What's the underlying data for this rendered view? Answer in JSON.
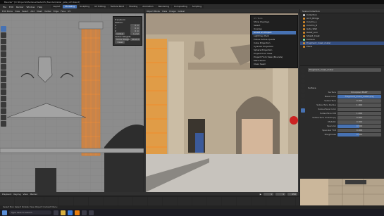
{
  "app": {
    "title": "Blender* [D:\\Projects\\Medieval\\Gate\\05_Blender\\zadar_gate_v03.blend]"
  },
  "menubar": {
    "items": [
      "File",
      "Edit",
      "Render",
      "Window",
      "Help"
    ],
    "workspaces": [
      "Layout",
      "Modeling",
      "Sculpting",
      "UV Editing",
      "Texture Paint",
      "Shading",
      "Animation",
      "Rendering",
      "Compositing",
      "Scripting"
    ],
    "active_workspace": "Modeling"
  },
  "left_viewport": {
    "header": [
      "Edit Mode",
      "View",
      "Select",
      "Add",
      "Mesh",
      "Vertex",
      "Edge",
      "Face",
      "UV"
    ],
    "npanel": {
      "title": "Transform",
      "rows": [
        {
          "label": "Median:",
          "value": ""
        },
        {
          "label": "X",
          "value": "0 m"
        },
        {
          "label": "Y",
          "value": "0 m"
        },
        {
          "label": "Z",
          "value": "0 m"
        },
        {
          "label": "Global",
          "value": "Local"
        },
        {
          "label": "Vertex Weights",
          "value": ""
        },
        {
          "label": "Show Weight",
          "value": "Stretch"
        },
        {
          "label": "Clean",
          "value": ""
        }
      ]
    }
  },
  "right_viewport": {
    "header": [
      "Object Mode",
      "View",
      "Image",
      "Global"
    ],
    "ctx_menu": {
      "title": "UV Tools",
      "items": [
        "Show Overlays",
        "Select",
        "Unwrap",
        "Smart UV Project",
        "Lightmap Pack",
        "Follow Active Quads",
        "Cube Projection",
        "Cylinder Projection",
        "Sphere Projection",
        "Project from View",
        "Project From View (Bounds)",
        "Mark Seam",
        "Clear Seam"
      ],
      "highlighted": 3
    }
  },
  "outliner": {
    "header": "Scene Collection",
    "items": [
      {
        "name": "Collection",
        "selected": false
      },
      {
        "name": "Arch_Bridge",
        "selected": false
      },
      {
        "name": "Column_L",
        "selected": false
      },
      {
        "name": "Column_R",
        "selected": false
      },
      {
        "name": "Gate_Wall",
        "selected": false
      },
      {
        "name": "Relief_Lion",
        "selected": false
      },
      {
        "name": "Shield_Crest",
        "selected": false
      },
      {
        "name": "Camera",
        "selected": false
      },
      {
        "name": "Fragment_mask_meter",
        "selected": true
      },
      {
        "name": "Plane",
        "selected": false
      }
    ]
  },
  "properties": {
    "object_name": "Fragment_mask_meter",
    "section": "Surface",
    "surface": "Principled BSDF",
    "rows": [
      {
        "label": "Base Color",
        "value": "Fragment_mask_meter.png",
        "style": "blue"
      },
      {
        "label": "Subsurface",
        "value": "0.000",
        "style": "normal"
      },
      {
        "label": "Subsurface Radius",
        "value": "1.000",
        "style": "normal"
      },
      {
        "label": "Subsurface Color",
        "value": "",
        "style": "normal"
      },
      {
        "label": "Subsurface IOR",
        "value": "1.400",
        "style": "normal"
      },
      {
        "label": "Subsurface Anisotropy",
        "value": "0.000",
        "style": "normal"
      },
      {
        "label": "Metallic",
        "value": "0.000",
        "style": "normal"
      },
      {
        "label": "Specular",
        "value": "0.500",
        "style": "bar",
        "fraction": 0.5
      },
      {
        "label": "Specular Tint",
        "value": "0.000",
        "style": "normal"
      },
      {
        "label": "Roughness",
        "value": "0.500",
        "style": "bar",
        "fraction": 0.5
      }
    ]
  },
  "timeline": {
    "header": [
      "Playback",
      "Keying",
      "View",
      "Marker"
    ],
    "frame": "1",
    "start": "1",
    "end": "250"
  },
  "statusbar": {
    "text": "Select    Box Select    Rotate View    Object Context Menu"
  },
  "taskbar": {
    "search_placeholder": "Type here to search"
  }
}
